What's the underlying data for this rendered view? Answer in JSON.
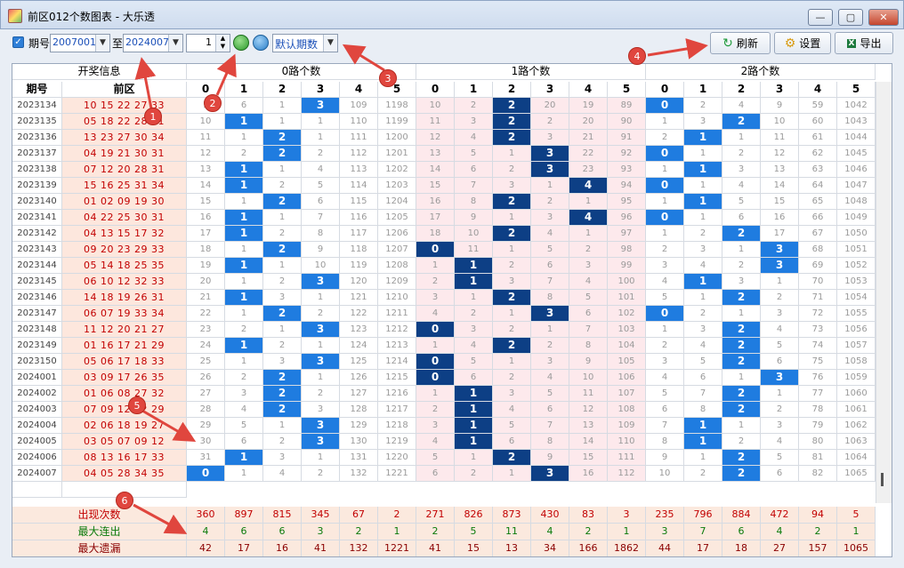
{
  "window": {
    "title": "前区012个数图表 - 大乐透",
    "min": "—",
    "max": "▢",
    "close": "✕"
  },
  "toolbar": {
    "period_label": "期号",
    "from": "2007001",
    "to_label": "至",
    "to": "2024007",
    "count": "1",
    "default": "默认期数",
    "refresh": "刷新",
    "settings": "设置",
    "export": "导出",
    "check": "✓"
  },
  "header": {
    "info": "开奖信息",
    "period": "期号",
    "front": "前区",
    "g0": "0路个数",
    "g1": "1路个数",
    "g2": "2路个数",
    "cols": [
      "0",
      "1",
      "2",
      "3",
      "4",
      "5",
      "0",
      "1",
      "2",
      "3",
      "4",
      "5",
      "0",
      "1",
      "2",
      "3",
      "4",
      "5"
    ]
  },
  "rows": [
    {
      "p": "2023134",
      "d": "10 15 22 27 33",
      "v": [
        1,
        6,
        1,
        3,
        109,
        1198,
        10,
        2,
        2,
        20,
        19,
        89,
        0,
        2,
        4,
        9,
        59,
        1042
      ],
      "h": [
        3,
        8,
        12
      ]
    },
    {
      "p": "2023135",
      "d": "05 18 22 28 31",
      "v": [
        10,
        1,
        1,
        1,
        110,
        1199,
        11,
        3,
        2,
        2,
        20,
        90,
        1,
        3,
        2,
        10,
        60,
        1043
      ],
      "h": [
        1,
        8,
        14
      ]
    },
    {
      "p": "2023136",
      "d": "13 23 27 30 34",
      "v": [
        11,
        1,
        2,
        1,
        111,
        1200,
        12,
        4,
        2,
        3,
        21,
        91,
        2,
        1,
        1,
        11,
        61,
        1044
      ],
      "h": [
        2,
        8,
        13
      ]
    },
    {
      "p": "2023137",
      "d": "04 19 21 30 31",
      "v": [
        12,
        2,
        2,
        2,
        112,
        1201,
        13,
        5,
        1,
        3,
        22,
        92,
        0,
        1,
        2,
        12,
        62,
        1045
      ],
      "h": [
        2,
        9,
        12
      ]
    },
    {
      "p": "2023138",
      "d": "07 12 20 28 31",
      "v": [
        13,
        1,
        1,
        4,
        113,
        1202,
        14,
        6,
        2,
        3,
        23,
        93,
        1,
        1,
        3,
        13,
        63,
        1046
      ],
      "h": [
        1,
        9,
        13
      ]
    },
    {
      "p": "2023139",
      "d": "15 16 25 31 34",
      "v": [
        14,
        1,
        2,
        5,
        114,
        1203,
        15,
        7,
        3,
        1,
        4,
        94,
        0,
        1,
        4,
        14,
        64,
        1047
      ],
      "h": [
        1,
        10,
        12
      ]
    },
    {
      "p": "2023140",
      "d": "01 02 09 19 30",
      "v": [
        15,
        1,
        2,
        6,
        115,
        1204,
        16,
        8,
        2,
        2,
        1,
        95,
        1,
        1,
        5,
        15,
        65,
        1048
      ],
      "h": [
        2,
        8,
        13
      ]
    },
    {
      "p": "2023141",
      "d": "04 22 25 30 31",
      "v": [
        16,
        1,
        1,
        7,
        116,
        1205,
        17,
        9,
        1,
        3,
        4,
        96,
        0,
        1,
        6,
        16,
        66,
        1049
      ],
      "h": [
        1,
        10,
        12
      ]
    },
    {
      "p": "2023142",
      "d": "04 13 15 17 32",
      "v": [
        17,
        1,
        2,
        8,
        117,
        1206,
        18,
        10,
        2,
        4,
        1,
        97,
        1,
        2,
        2,
        17,
        67,
        1050
      ],
      "h": [
        1,
        8,
        14
      ]
    },
    {
      "p": "2023143",
      "d": "09 20 23 29 33",
      "v": [
        18,
        1,
        2,
        9,
        118,
        1207,
        0,
        11,
        1,
        5,
        2,
        98,
        2,
        3,
        1,
        3,
        68,
        1051
      ],
      "h": [
        2,
        6,
        15
      ]
    },
    {
      "p": "2023144",
      "d": "05 14 18 25 35",
      "v": [
        19,
        1,
        1,
        10,
        119,
        1208,
        1,
        1,
        2,
        6,
        3,
        99,
        3,
        4,
        2,
        3,
        69,
        1052
      ],
      "h": [
        1,
        7,
        15
      ]
    },
    {
      "p": "2023145",
      "d": "06 10 12 32 33",
      "v": [
        20,
        1,
        2,
        3,
        120,
        1209,
        2,
        1,
        3,
        7,
        4,
        100,
        4,
        1,
        3,
        1,
        70,
        1053
      ],
      "h": [
        3,
        7,
        13
      ]
    },
    {
      "p": "2023146",
      "d": "14 18 19 26 31",
      "v": [
        21,
        1,
        3,
        1,
        121,
        1210,
        3,
        1,
        2,
        8,
        5,
        101,
        5,
        1,
        2,
        2,
        71,
        1054
      ],
      "h": [
        1,
        8,
        14
      ]
    },
    {
      "p": "2023147",
      "d": "06 07 19 33 34",
      "v": [
        22,
        1,
        2,
        2,
        122,
        1211,
        4,
        2,
        1,
        3,
        6,
        102,
        0,
        2,
        1,
        3,
        72,
        1055
      ],
      "h": [
        2,
        9,
        12
      ]
    },
    {
      "p": "2023148",
      "d": "11 12 20 21 27",
      "v": [
        23,
        2,
        1,
        3,
        123,
        1212,
        0,
        3,
        2,
        1,
        7,
        103,
        1,
        3,
        2,
        4,
        73,
        1056
      ],
      "h": [
        3,
        6,
        14
      ]
    },
    {
      "p": "2023149",
      "d": "01 16 17 21 29",
      "v": [
        24,
        1,
        2,
        1,
        124,
        1213,
        1,
        4,
        2,
        2,
        8,
        104,
        2,
        4,
        2,
        5,
        74,
        1057
      ],
      "h": [
        1,
        8,
        14
      ]
    },
    {
      "p": "2023150",
      "d": "05 06 17 18 33",
      "v": [
        25,
        1,
        3,
        3,
        125,
        1214,
        0,
        5,
        1,
        3,
        9,
        105,
        3,
        5,
        2,
        6,
        75,
        1058
      ],
      "h": [
        3,
        6,
        14
      ]
    },
    {
      "p": "2024001",
      "d": "03 09 17 26 35",
      "v": [
        26,
        2,
        2,
        1,
        126,
        1215,
        0,
        6,
        2,
        4,
        10,
        106,
        4,
        6,
        1,
        3,
        76,
        1059
      ],
      "h": [
        2,
        6,
        15
      ]
    },
    {
      "p": "2024002",
      "d": "01 06 08 27 32",
      "v": [
        27,
        3,
        2,
        2,
        127,
        1216,
        1,
        1,
        3,
        5,
        11,
        107,
        5,
        7,
        2,
        1,
        77,
        1060
      ],
      "h": [
        2,
        7,
        14
      ]
    },
    {
      "p": "2024003",
      "d": "07 09 12 22 29",
      "v": [
        28,
        4,
        2,
        3,
        128,
        1217,
        2,
        1,
        4,
        6,
        12,
        108,
        6,
        8,
        2,
        2,
        78,
        1061
      ],
      "h": [
        2,
        7,
        14
      ]
    },
    {
      "p": "2024004",
      "d": "02 06 18 19 27",
      "v": [
        29,
        5,
        1,
        3,
        129,
        1218,
        3,
        1,
        5,
        7,
        13,
        109,
        7,
        1,
        1,
        3,
        79,
        1062
      ],
      "h": [
        3,
        7,
        13
      ]
    },
    {
      "p": "2024005",
      "d": "03 05 07 09 12",
      "v": [
        30,
        6,
        2,
        3,
        130,
        1219,
        4,
        1,
        6,
        8,
        14,
        110,
        8,
        1,
        2,
        4,
        80,
        1063
      ],
      "h": [
        3,
        7,
        13
      ]
    },
    {
      "p": "2024006",
      "d": "08 13 16 17 33",
      "v": [
        31,
        1,
        3,
        1,
        131,
        1220,
        5,
        1,
        2,
        9,
        15,
        111,
        9,
        1,
        2,
        5,
        81,
        1064
      ],
      "h": [
        1,
        8,
        14
      ]
    },
    {
      "p": "2024007",
      "d": "04 05 28 34 35",
      "v": [
        0,
        1,
        4,
        2,
        132,
        1221,
        6,
        2,
        1,
        3,
        16,
        112,
        10,
        2,
        2,
        6,
        82,
        1065
      ],
      "h": [
        0,
        9,
        14
      ]
    }
  ],
  "footer": [
    {
      "label": "出现次数",
      "color": "#c20000",
      "v": [
        "360",
        "897",
        "815",
        "345",
        "67",
        "2",
        "271",
        "826",
        "873",
        "430",
        "83",
        "3",
        "235",
        "796",
        "884",
        "472",
        "94",
        "5"
      ]
    },
    {
      "label": "最大连出",
      "color": "#0a7a0a",
      "v": [
        "4",
        "6",
        "6",
        "3",
        "2",
        "1",
        "2",
        "5",
        "11",
        "4",
        "2",
        "1",
        "3",
        "7",
        "6",
        "4",
        "2",
        "1"
      ]
    },
    {
      "label": "最大遗漏",
      "color": "#8b0000",
      "v": [
        "42",
        "17",
        "16",
        "41",
        "132",
        "1221",
        "41",
        "15",
        "13",
        "34",
        "166",
        "1862",
        "44",
        "17",
        "18",
        "27",
        "157",
        "1065"
      ]
    }
  ],
  "badges": [
    "1",
    "2",
    "3",
    "4",
    "5",
    "6"
  ],
  "colors": {
    "hit_light": "#1f7ce0",
    "hit_dark": "#0d3f85",
    "pink": "#fde9ec",
    "draw_bg": "#fde7dd",
    "badge": "#e0463e"
  }
}
